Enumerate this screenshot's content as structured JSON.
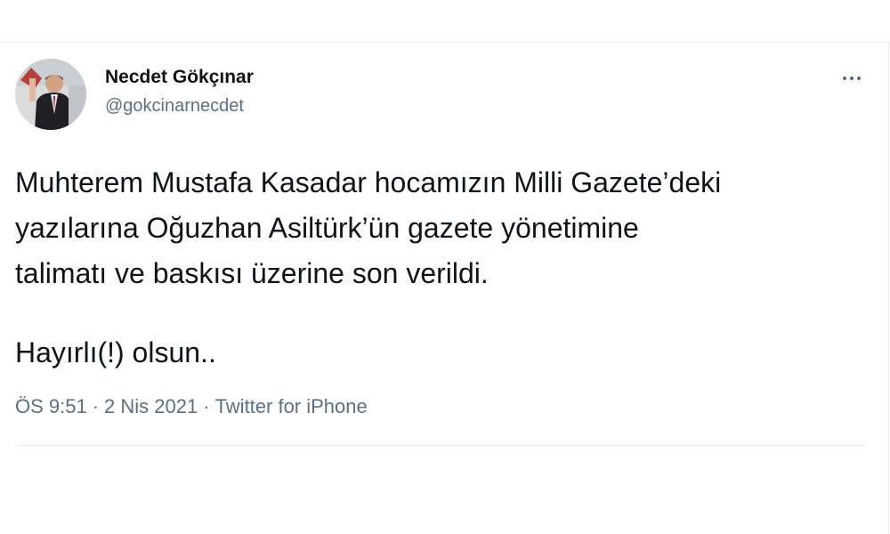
{
  "author": {
    "name": "Necdet Gökçınar",
    "handle": "@gokcinarnecdet"
  },
  "tweet": {
    "lines": [
      "Muhterem Mustafa Kasadar hocamızın Milli Gazete’deki",
      "yazılarına Oğuzhan Asiltürk’ün gazete yönetimine",
      "talimatı ve baskısı üzerine son verildi."
    ],
    "closing": "Hayırlı(!) olsun.."
  },
  "meta": {
    "time": "ÖS 9:51",
    "separator": "·",
    "date": "2 Nis 2021",
    "source": "Twitter for iPhone"
  },
  "icons": {
    "more": "more-options-icon"
  },
  "colors": {
    "text": "#0f1419",
    "secondary": "#5b7083",
    "divider": "#ebeef0"
  }
}
